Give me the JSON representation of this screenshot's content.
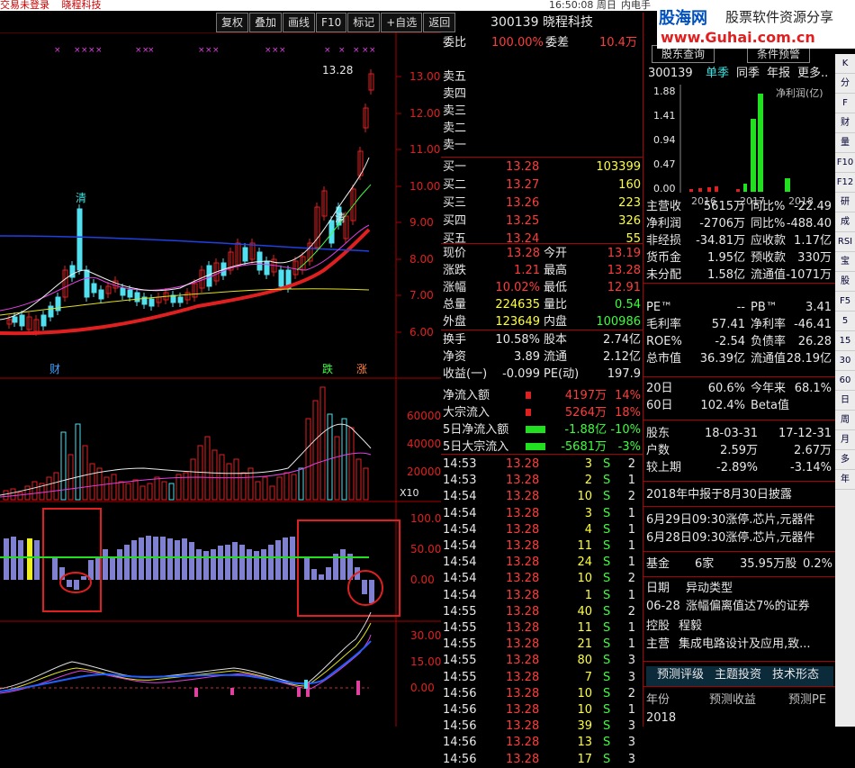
{
  "topbar": {
    "left": "交易未登录",
    "stock": "晓程科技",
    "time": "16:50:08 周日",
    "net": "内电手"
  },
  "toolbar": [
    "复权",
    "叠加",
    "画线",
    "F10",
    "标记",
    "+自选",
    "返回"
  ],
  "chart": {
    "price_labels": [
      "13.00",
      "12.00",
      "11.00",
      "10.00",
      "9.00",
      "8.00",
      "7.00",
      "6.00"
    ],
    "vol_labels": [
      "60000",
      "40000",
      "20000"
    ],
    "vol_unit": "X10",
    "ind1_labels": [
      "100.0",
      "50.00",
      "0.00"
    ],
    "ind2_labels": [
      "30.00",
      "15.00",
      "0.00"
    ],
    "high_tag": "13.28",
    "marks": {
      "qing1": "清",
      "qing2": "清",
      "cai": "财",
      "die": "跌",
      "zhang": "涨"
    }
  },
  "quote": {
    "title": "300139 晓程科技",
    "weibi_label": "委比",
    "weibi": "100.00%",
    "weicha_label": "委差",
    "weicha": "10.4万",
    "sells": [
      "卖五",
      "卖四",
      "卖三",
      "卖二",
      "卖一"
    ],
    "buys": [
      {
        "l": "买一",
        "p": "13.28",
        "v": "103399"
      },
      {
        "l": "买二",
        "p": "13.27",
        "v": "160"
      },
      {
        "l": "买三",
        "p": "13.26",
        "v": "223"
      },
      {
        "l": "买四",
        "p": "13.25",
        "v": "326"
      },
      {
        "l": "买五",
        "p": "13.24",
        "v": "55"
      }
    ],
    "stats": [
      {
        "a": "现价",
        "av": "13.28",
        "b": "今开",
        "bv": "13.19"
      },
      {
        "a": "涨跌",
        "av": "1.21",
        "b": "最高",
        "bv": "13.28"
      },
      {
        "a": "涨幅",
        "av": "10.02%",
        "b": "最低",
        "bv": "12.91"
      },
      {
        "a": "总量",
        "av": "224635",
        "b": "量比",
        "bv": "0.54"
      },
      {
        "a": "外盘",
        "av": "123649",
        "b": "内盘",
        "bv": "100986"
      }
    ],
    "stats2": [
      {
        "a": "换手",
        "av": "10.58%",
        "b": "股本",
        "bv": "2.74亿"
      },
      {
        "a": "净资",
        "av": "3.89",
        "b": "流通",
        "bv": "2.12亿"
      },
      {
        "a": "收益(一)",
        "av": "-0.099",
        "b": "PE(动)",
        "bv": "197.9"
      }
    ],
    "flows": [
      {
        "l": "净流入额",
        "v": "4197万",
        "p": "14%"
      },
      {
        "l": "大宗流入",
        "v": "5264万",
        "p": "18%"
      },
      {
        "l": "5日净流入额",
        "v": "-1.88亿",
        "p": "-10%"
      },
      {
        "l": "5日大宗流入",
        "v": "-5681万",
        "p": "-3%"
      }
    ],
    "ticks": [
      [
        "14:53",
        "13.28",
        "3",
        "S",
        "2"
      ],
      [
        "14:53",
        "13.28",
        "2",
        "S",
        "1"
      ],
      [
        "14:54",
        "13.28",
        "10",
        "S",
        "2"
      ],
      [
        "14:54",
        "13.28",
        "3",
        "S",
        "1"
      ],
      [
        "14:54",
        "13.28",
        "4",
        "S",
        "1"
      ],
      [
        "14:54",
        "13.28",
        "11",
        "S",
        "1"
      ],
      [
        "14:54",
        "13.28",
        "24",
        "S",
        "1"
      ],
      [
        "14:54",
        "13.28",
        "10",
        "S",
        "2"
      ],
      [
        "14:54",
        "13.28",
        "1",
        "S",
        "1"
      ],
      [
        "14:55",
        "13.28",
        "40",
        "S",
        "2"
      ],
      [
        "14:55",
        "13.28",
        "11",
        "S",
        "1"
      ],
      [
        "14:55",
        "13.28",
        "21",
        "S",
        "1"
      ],
      [
        "14:55",
        "13.28",
        "80",
        "S",
        "3"
      ],
      [
        "14:55",
        "13.28",
        "7",
        "S",
        "3"
      ],
      [
        "14:56",
        "13.28",
        "10",
        "S",
        "2"
      ],
      [
        "14:56",
        "13.28",
        "10",
        "S",
        "1"
      ],
      [
        "14:56",
        "13.28",
        "39",
        "S",
        "3"
      ],
      [
        "14:56",
        "13.28",
        "13",
        "S",
        "3"
      ],
      [
        "14:56",
        "13.28",
        "17",
        "S",
        "3"
      ]
    ]
  },
  "right": {
    "btn1": "股东查询",
    "btn2": "条件预警",
    "code": "300139",
    "tab1": "单季",
    "tab2": "同季",
    "tab3": "年报",
    "tab4": "更多..",
    "chart_title": "净利润(亿)",
    "years": [
      "2016",
      "2017",
      "2018"
    ],
    "ylabels": [
      "1.88",
      "1.41",
      "0.94",
      "0.47",
      "0.00"
    ],
    "fin": [
      [
        "主营收",
        "5615万",
        "同比%",
        "-22.49"
      ],
      [
        "净利润",
        "-2706万",
        "同比%",
        "-488.40"
      ],
      [
        "非经损",
        "-34.81万",
        "应收款",
        "1.17亿"
      ],
      [
        "货币金",
        "1.95亿",
        "预收款",
        "330万"
      ],
      [
        "未分配",
        "1.58亿",
        "流通值",
        "-1071万"
      ]
    ],
    "fin2": [
      [
        "PE™",
        "--",
        "PB™",
        "3.41"
      ],
      [
        "毛利率",
        "57.41",
        "净利率",
        "-46.41"
      ],
      [
        "ROE%",
        "-2.54",
        "负债率",
        "26.28"
      ],
      [
        "总市值",
        "36.39亿",
        "流通值",
        "28.19亿"
      ]
    ],
    "perf": [
      [
        "20日",
        "60.6%",
        "今年来",
        "68.1%"
      ],
      [
        "60日",
        "102.4%",
        "Beta值",
        ""
      ]
    ],
    "holders": [
      [
        "股东",
        "18-03-31",
        "17-12-31"
      ],
      [
        "户数",
        "2.59万",
        "2.67万"
      ],
      [
        "较上期",
        "-2.89%",
        "-3.14%"
      ]
    ],
    "notice": "2018年中报于8月30日披露",
    "news": [
      "6月29日09:30涨停.芯片,元器件",
      "6月28日09:30涨停.芯片,元器件"
    ],
    "fund": [
      "基金",
      "6家",
      "35.95万股",
      "0.2%"
    ],
    "events": [
      [
        "日期",
        "异动类型"
      ],
      [
        "06-28",
        "涨幅偏离值达7%的证券"
      ]
    ],
    "ctrl": [
      "控股",
      "程毅"
    ],
    "business": [
      "主营",
      "集成电路设计及应用,致..."
    ],
    "bottom_tabs": [
      "预测评级",
      "主题投资",
      "技术形态"
    ],
    "forecast": [
      "年份",
      "预测收益",
      "预测PE"
    ],
    "forecast_year": "2018"
  },
  "icons": [
    "K",
    "分",
    "F",
    "财",
    "量",
    "F10",
    "F12",
    "研",
    "成",
    "RSI",
    "宝",
    "股",
    "F5",
    "5",
    "15",
    "30",
    "60",
    "日",
    "周",
    "月",
    "多",
    "年"
  ],
  "logo": {
    "main": "股海网",
    "slogan": "股票软件资源分享",
    "url": "www.Guhai.com.cn"
  }
}
